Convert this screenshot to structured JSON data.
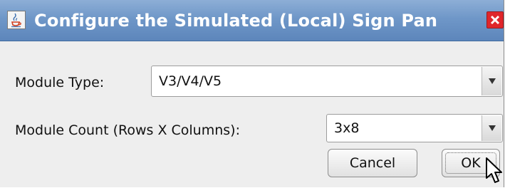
{
  "window": {
    "title": "Configure the Simulated (Local) Sign Pan",
    "icons": {
      "app": "java-cup-icon",
      "close": "close-x-icon"
    }
  },
  "form": {
    "module_type_label": "Module Type:",
    "module_type_value": "V3/V4/V5",
    "module_count_label": "Module Count (Rows X Columns):",
    "module_count_value": "3x8"
  },
  "buttons": {
    "cancel": "Cancel",
    "ok": "OK"
  },
  "colors": {
    "titlebar": "#6f97c8",
    "close": "#e0262b",
    "window_bg": "#eeeeee"
  }
}
